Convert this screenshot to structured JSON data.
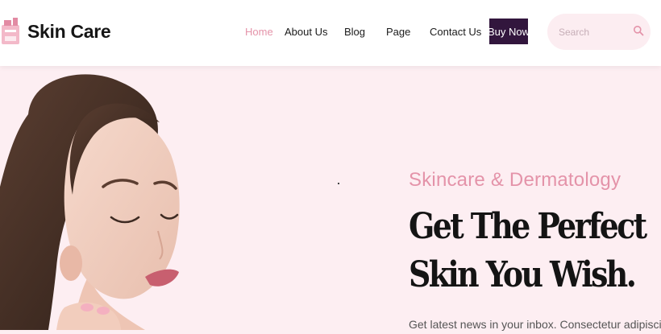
{
  "brand": {
    "name": "Skin Care",
    "icon": "cosmetics-icon"
  },
  "nav": {
    "items": [
      {
        "label": "Home",
        "active": true
      },
      {
        "label": "About Us",
        "active": false
      },
      {
        "label": "Blog",
        "active": false
      },
      {
        "label": "Page",
        "active": false
      },
      {
        "label": "Contact Us",
        "active": false
      }
    ],
    "buy_label": "Buy Now"
  },
  "search": {
    "placeholder": "Search",
    "icon": "search-icon"
  },
  "hero": {
    "eyebrow": "Skincare & Dermatology",
    "headline_line1": "Get The Perfect",
    "headline_line2": "Skin You Wish.",
    "subtext": "Get latest news in your inbox. Consectetur adipiscing"
  },
  "colors": {
    "accent_pink": "#e493a9",
    "button_dark": "#32163d",
    "hero_background": "#fdeef2",
    "text_dark": "#141414"
  }
}
